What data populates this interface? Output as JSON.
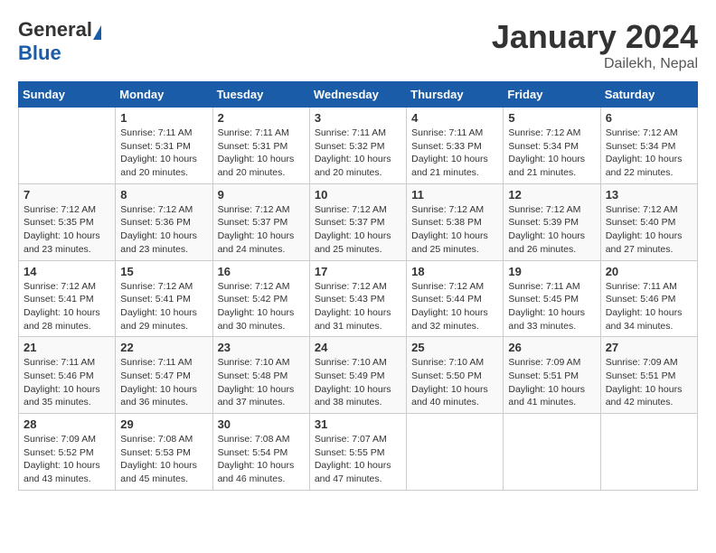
{
  "logo": {
    "general": "General",
    "blue": "Blue"
  },
  "title": {
    "month": "January 2024",
    "location": "Dailekh, Nepal"
  },
  "calendar": {
    "headers": [
      "Sunday",
      "Monday",
      "Tuesday",
      "Wednesday",
      "Thursday",
      "Friday",
      "Saturday"
    ],
    "weeks": [
      [
        {
          "day": "",
          "sunrise": "",
          "sunset": "",
          "daylight": ""
        },
        {
          "day": "1",
          "sunrise": "Sunrise: 7:11 AM",
          "sunset": "Sunset: 5:31 PM",
          "daylight": "Daylight: 10 hours and 20 minutes."
        },
        {
          "day": "2",
          "sunrise": "Sunrise: 7:11 AM",
          "sunset": "Sunset: 5:31 PM",
          "daylight": "Daylight: 10 hours and 20 minutes."
        },
        {
          "day": "3",
          "sunrise": "Sunrise: 7:11 AM",
          "sunset": "Sunset: 5:32 PM",
          "daylight": "Daylight: 10 hours and 20 minutes."
        },
        {
          "day": "4",
          "sunrise": "Sunrise: 7:11 AM",
          "sunset": "Sunset: 5:33 PM",
          "daylight": "Daylight: 10 hours and 21 minutes."
        },
        {
          "day": "5",
          "sunrise": "Sunrise: 7:12 AM",
          "sunset": "Sunset: 5:34 PM",
          "daylight": "Daylight: 10 hours and 21 minutes."
        },
        {
          "day": "6",
          "sunrise": "Sunrise: 7:12 AM",
          "sunset": "Sunset: 5:34 PM",
          "daylight": "Daylight: 10 hours and 22 minutes."
        }
      ],
      [
        {
          "day": "7",
          "sunrise": "Sunrise: 7:12 AM",
          "sunset": "Sunset: 5:35 PM",
          "daylight": "Daylight: 10 hours and 23 minutes."
        },
        {
          "day": "8",
          "sunrise": "Sunrise: 7:12 AM",
          "sunset": "Sunset: 5:36 PM",
          "daylight": "Daylight: 10 hours and 23 minutes."
        },
        {
          "day": "9",
          "sunrise": "Sunrise: 7:12 AM",
          "sunset": "Sunset: 5:37 PM",
          "daylight": "Daylight: 10 hours and 24 minutes."
        },
        {
          "day": "10",
          "sunrise": "Sunrise: 7:12 AM",
          "sunset": "Sunset: 5:37 PM",
          "daylight": "Daylight: 10 hours and 25 minutes."
        },
        {
          "day": "11",
          "sunrise": "Sunrise: 7:12 AM",
          "sunset": "Sunset: 5:38 PM",
          "daylight": "Daylight: 10 hours and 25 minutes."
        },
        {
          "day": "12",
          "sunrise": "Sunrise: 7:12 AM",
          "sunset": "Sunset: 5:39 PM",
          "daylight": "Daylight: 10 hours and 26 minutes."
        },
        {
          "day": "13",
          "sunrise": "Sunrise: 7:12 AM",
          "sunset": "Sunset: 5:40 PM",
          "daylight": "Daylight: 10 hours and 27 minutes."
        }
      ],
      [
        {
          "day": "14",
          "sunrise": "Sunrise: 7:12 AM",
          "sunset": "Sunset: 5:41 PM",
          "daylight": "Daylight: 10 hours and 28 minutes."
        },
        {
          "day": "15",
          "sunrise": "Sunrise: 7:12 AM",
          "sunset": "Sunset: 5:41 PM",
          "daylight": "Daylight: 10 hours and 29 minutes."
        },
        {
          "day": "16",
          "sunrise": "Sunrise: 7:12 AM",
          "sunset": "Sunset: 5:42 PM",
          "daylight": "Daylight: 10 hours and 30 minutes."
        },
        {
          "day": "17",
          "sunrise": "Sunrise: 7:12 AM",
          "sunset": "Sunset: 5:43 PM",
          "daylight": "Daylight: 10 hours and 31 minutes."
        },
        {
          "day": "18",
          "sunrise": "Sunrise: 7:12 AM",
          "sunset": "Sunset: 5:44 PM",
          "daylight": "Daylight: 10 hours and 32 minutes."
        },
        {
          "day": "19",
          "sunrise": "Sunrise: 7:11 AM",
          "sunset": "Sunset: 5:45 PM",
          "daylight": "Daylight: 10 hours and 33 minutes."
        },
        {
          "day": "20",
          "sunrise": "Sunrise: 7:11 AM",
          "sunset": "Sunset: 5:46 PM",
          "daylight": "Daylight: 10 hours and 34 minutes."
        }
      ],
      [
        {
          "day": "21",
          "sunrise": "Sunrise: 7:11 AM",
          "sunset": "Sunset: 5:46 PM",
          "daylight": "Daylight: 10 hours and 35 minutes."
        },
        {
          "day": "22",
          "sunrise": "Sunrise: 7:11 AM",
          "sunset": "Sunset: 5:47 PM",
          "daylight": "Daylight: 10 hours and 36 minutes."
        },
        {
          "day": "23",
          "sunrise": "Sunrise: 7:10 AM",
          "sunset": "Sunset: 5:48 PM",
          "daylight": "Daylight: 10 hours and 37 minutes."
        },
        {
          "day": "24",
          "sunrise": "Sunrise: 7:10 AM",
          "sunset": "Sunset: 5:49 PM",
          "daylight": "Daylight: 10 hours and 38 minutes."
        },
        {
          "day": "25",
          "sunrise": "Sunrise: 7:10 AM",
          "sunset": "Sunset: 5:50 PM",
          "daylight": "Daylight: 10 hours and 40 minutes."
        },
        {
          "day": "26",
          "sunrise": "Sunrise: 7:09 AM",
          "sunset": "Sunset: 5:51 PM",
          "daylight": "Daylight: 10 hours and 41 minutes."
        },
        {
          "day": "27",
          "sunrise": "Sunrise: 7:09 AM",
          "sunset": "Sunset: 5:51 PM",
          "daylight": "Daylight: 10 hours and 42 minutes."
        }
      ],
      [
        {
          "day": "28",
          "sunrise": "Sunrise: 7:09 AM",
          "sunset": "Sunset: 5:52 PM",
          "daylight": "Daylight: 10 hours and 43 minutes."
        },
        {
          "day": "29",
          "sunrise": "Sunrise: 7:08 AM",
          "sunset": "Sunset: 5:53 PM",
          "daylight": "Daylight: 10 hours and 45 minutes."
        },
        {
          "day": "30",
          "sunrise": "Sunrise: 7:08 AM",
          "sunset": "Sunset: 5:54 PM",
          "daylight": "Daylight: 10 hours and 46 minutes."
        },
        {
          "day": "31",
          "sunrise": "Sunrise: 7:07 AM",
          "sunset": "Sunset: 5:55 PM",
          "daylight": "Daylight: 10 hours and 47 minutes."
        },
        {
          "day": "",
          "sunrise": "",
          "sunset": "",
          "daylight": ""
        },
        {
          "day": "",
          "sunrise": "",
          "sunset": "",
          "daylight": ""
        },
        {
          "day": "",
          "sunrise": "",
          "sunset": "",
          "daylight": ""
        }
      ]
    ]
  }
}
